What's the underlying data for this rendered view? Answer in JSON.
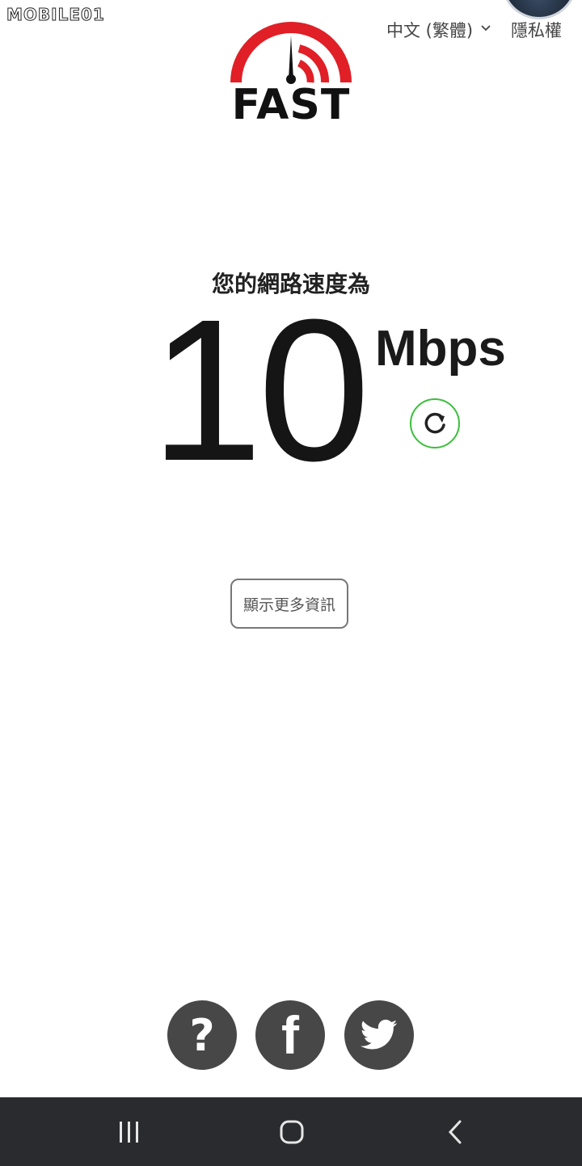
{
  "watermark": "MOBILE01",
  "header": {
    "language_label": "中文 (繁體)",
    "privacy_label": "隱私權"
  },
  "logo": {
    "text": "FAST"
  },
  "result": {
    "title": "您的網路速度為",
    "value": "10",
    "units": "Mbps"
  },
  "actions": {
    "more_info_label": "顯示更多資訊"
  },
  "social": {
    "help_glyph": "?",
    "facebook_glyph": "f"
  },
  "colors": {
    "brand_red": "#e01f26",
    "refresh_green": "#3cbf3c",
    "social_bg": "#474747",
    "navbar_bg": "#2a2b2e"
  }
}
